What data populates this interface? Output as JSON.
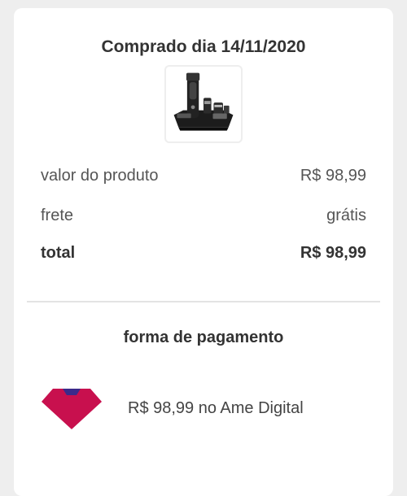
{
  "purchase": {
    "title": "Comprado dia 14/11/2020"
  },
  "product_image": {
    "icon": "hair-trimmer-kit-image"
  },
  "summary": {
    "rows": [
      {
        "label": "valor do produto",
        "value": "R$ 98,99"
      },
      {
        "label": "frete",
        "value": "grátis"
      },
      {
        "label": "total",
        "value": "R$ 98,99"
      }
    ]
  },
  "payment": {
    "title": "forma de pagamento",
    "method_text": "R$ 98,99 no Ame Digital",
    "icon": "ame-digital-logo",
    "colors": {
      "primary": "#c8104e",
      "accent": "#3b2a8a"
    }
  }
}
